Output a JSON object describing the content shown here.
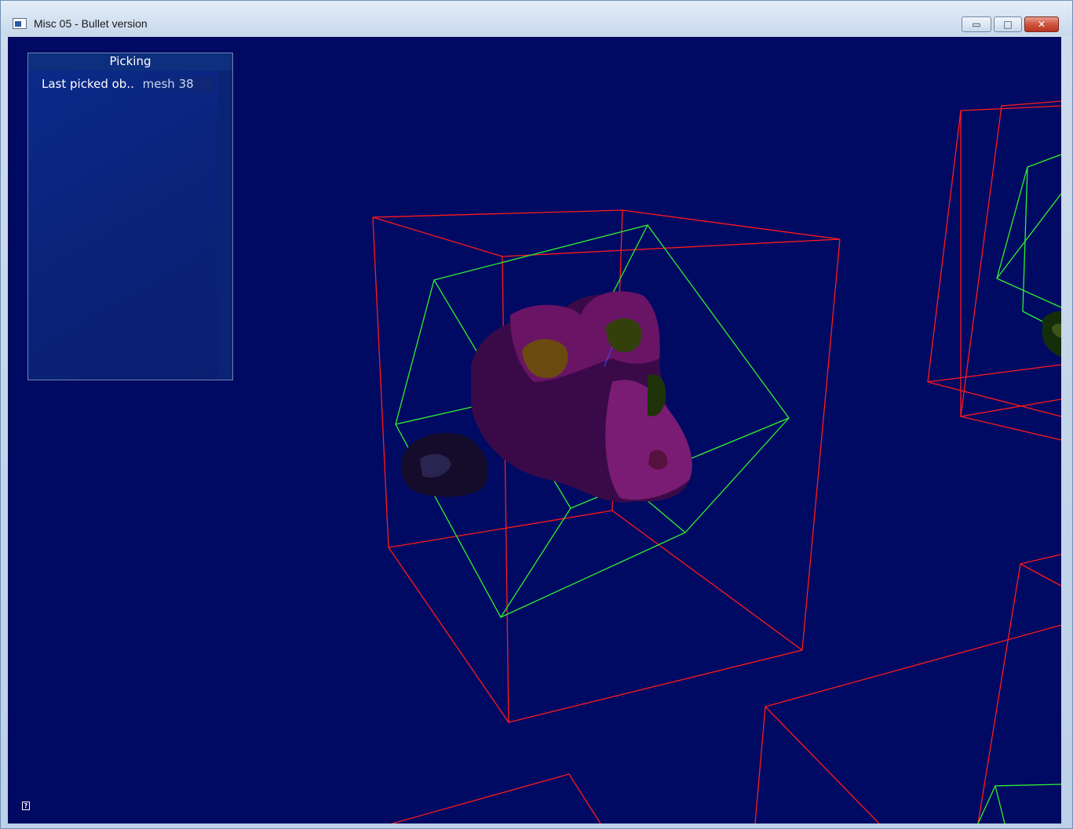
{
  "window": {
    "title": "Misc 05 - Bullet version",
    "controls": {
      "minimize": "▭",
      "maximize": "□",
      "close": "✕"
    }
  },
  "panel": {
    "title": "Picking",
    "row_label": "Last picked ob..",
    "row_value": "mesh 38"
  },
  "help": {
    "glyph": "?"
  },
  "colors": {
    "viewport_bg": "#000a63",
    "bbox_red": "#ff1a1a",
    "bbox_green": "#2ff02f",
    "mesh_purple": "#7a1b74"
  }
}
